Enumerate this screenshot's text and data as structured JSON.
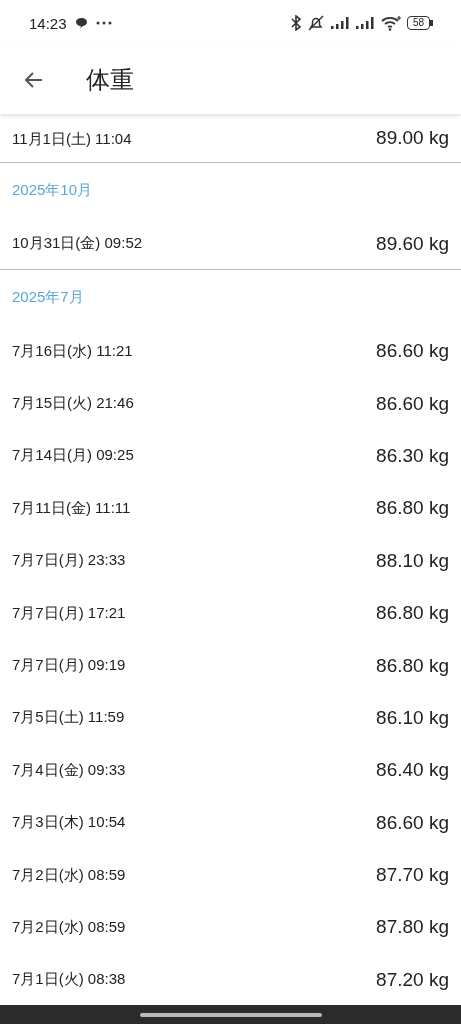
{
  "status_bar": {
    "time": "14:23",
    "battery": "58"
  },
  "header": {
    "title": "体重"
  },
  "clipped_entry": {
    "date": "11月1日(土) 11:04",
    "weight": "89.00 kg"
  },
  "sections": [
    {
      "label": "2025年10月",
      "entries": [
        {
          "date": "10月31日(金) 09:52",
          "weight": "89.60 kg"
        }
      ]
    },
    {
      "label": "2025年7月",
      "entries": [
        {
          "date": "7月16日(水) 11:21",
          "weight": "86.60 kg"
        },
        {
          "date": "7月15日(火) 21:46",
          "weight": "86.60 kg"
        },
        {
          "date": "7月14日(月) 09:25",
          "weight": "86.30 kg"
        },
        {
          "date": "7月11日(金) 11:11",
          "weight": "86.80 kg"
        },
        {
          "date": "7月7日(月) 23:33",
          "weight": "88.10 kg"
        },
        {
          "date": "7月7日(月) 17:21",
          "weight": "86.80 kg"
        },
        {
          "date": "7月7日(月) 09:19",
          "weight": "86.80 kg"
        },
        {
          "date": "7月5日(土) 11:59",
          "weight": "86.10 kg"
        },
        {
          "date": "7月4日(金) 09:33",
          "weight": "86.40 kg"
        },
        {
          "date": "7月3日(木) 10:54",
          "weight": "86.60 kg"
        },
        {
          "date": "7月2日(水) 08:59",
          "weight": "87.70 kg"
        },
        {
          "date": "7月2日(水) 08:59",
          "weight": "87.80 kg"
        },
        {
          "date": "7月1日(火) 08:38",
          "weight": "87.20 kg"
        }
      ]
    }
  ]
}
